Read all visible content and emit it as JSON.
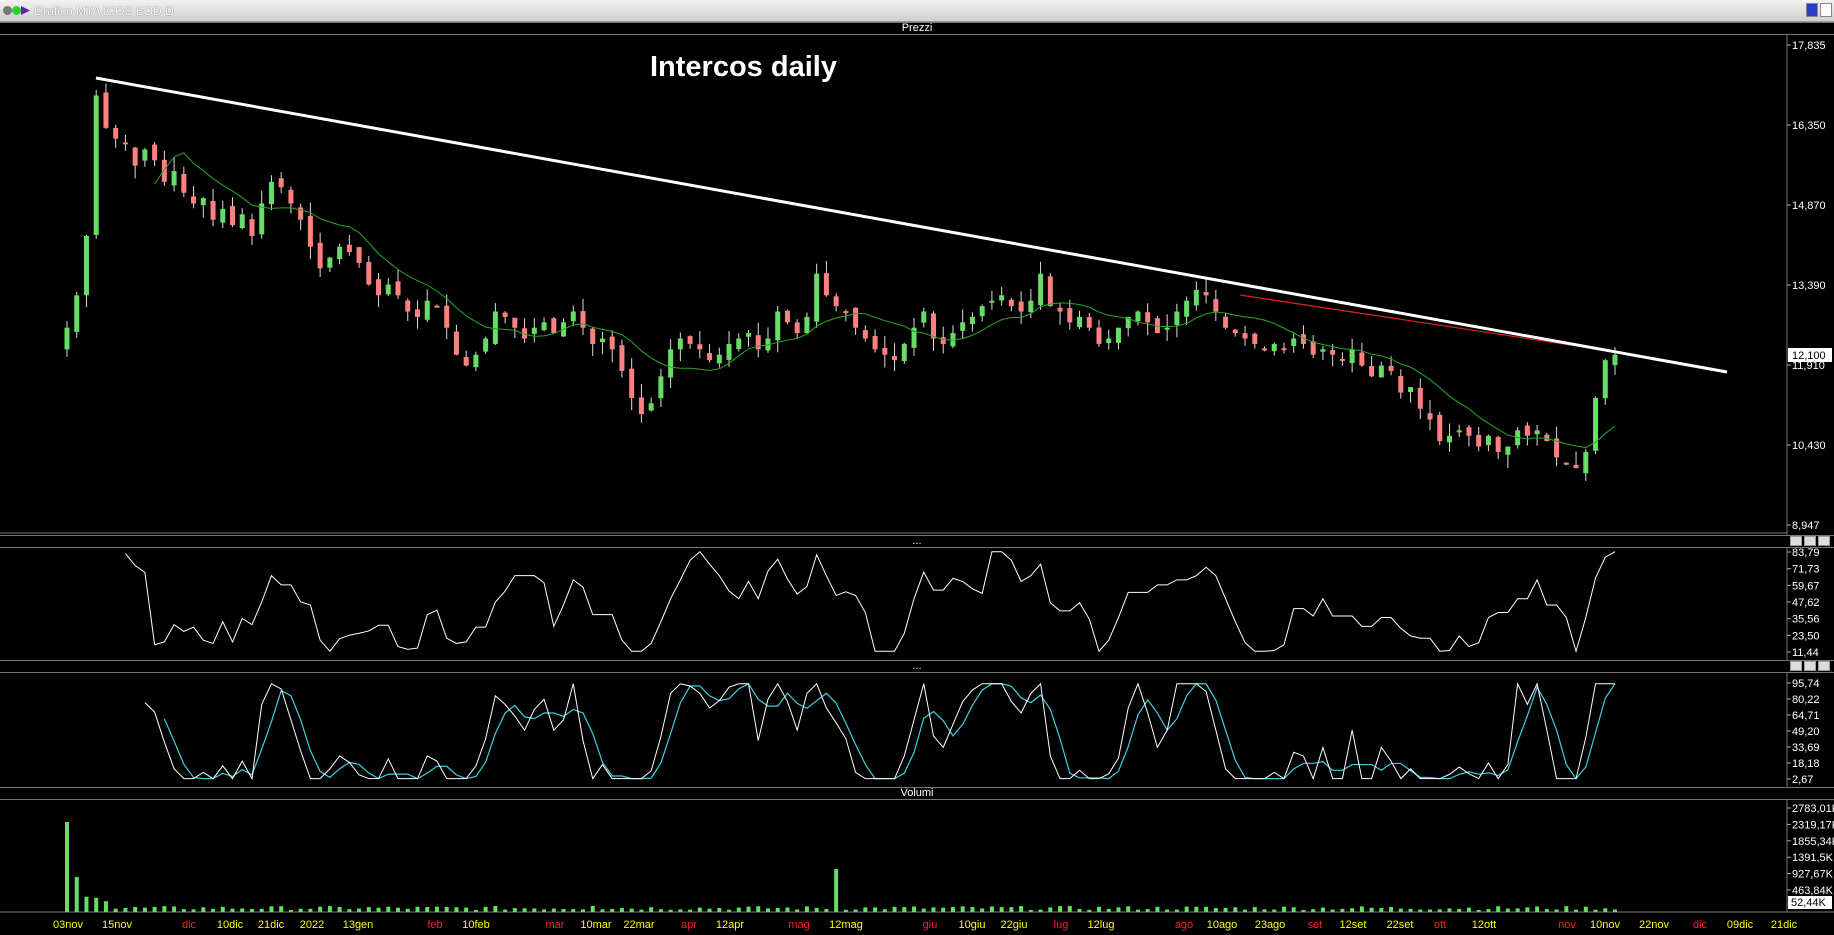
{
  "window": {
    "title": "Grafico MTA ICOS EOD D"
  },
  "panels": {
    "price": {
      "header": "Prezzi",
      "annotation": "Intercos daily",
      "ticks": [
        "17,835",
        "16,350",
        "14,870",
        "13,390",
        "11,910",
        "10,430",
        "8,947"
      ],
      "last_price": "12,100"
    },
    "osc1": {
      "header": "...",
      "ticks": [
        "83,79",
        "71,73",
        "59,67",
        "47,62",
        "35,56",
        "23,50",
        "11,44"
      ]
    },
    "osc2": {
      "header": "...",
      "ticks": [
        "95,74",
        "80,22",
        "64,71",
        "49,20",
        "33,69",
        "18,18",
        "2,67"
      ]
    },
    "volume": {
      "header": "Volumi",
      "ticks": [
        "2783,01K",
        "2319,17K",
        "1855,34K",
        "1391,5K",
        "927,67K",
        "463,84K"
      ],
      "last_volume": "52,44K"
    }
  },
  "date_axis": [
    {
      "label": "03nov",
      "color": "#ffff00"
    },
    {
      "label": "15nov",
      "color": "#ffff00"
    },
    {
      "label": "dic",
      "color": "#ff2020"
    },
    {
      "label": "10dic",
      "color": "#ffff00"
    },
    {
      "label": "21dic",
      "color": "#ffff00"
    },
    {
      "label": "2022",
      "color": "#ffff00"
    },
    {
      "label": "13gen",
      "color": "#ffff00"
    },
    {
      "label": "feb",
      "color": "#ff2020"
    },
    {
      "label": "10feb",
      "color": "#ffff00"
    },
    {
      "label": "mar",
      "color": "#ff2020"
    },
    {
      "label": "10mar",
      "color": "#ffff00"
    },
    {
      "label": "22mar",
      "color": "#ffff00"
    },
    {
      "label": "apr",
      "color": "#ff2020"
    },
    {
      "label": "12apr",
      "color": "#ffff00"
    },
    {
      "label": "mag",
      "color": "#ff2020"
    },
    {
      "label": "12mag",
      "color": "#ffff00"
    },
    {
      "label": "giu",
      "color": "#ff2020"
    },
    {
      "label": "10giu",
      "color": "#ffff00"
    },
    {
      "label": "22giu",
      "color": "#ffff00"
    },
    {
      "label": "lug",
      "color": "#ff2020"
    },
    {
      "label": "12lug",
      "color": "#ffff00"
    },
    {
      "label": "ago",
      "color": "#ff2020"
    },
    {
      "label": "10ago",
      "color": "#ffff00"
    },
    {
      "label": "23ago",
      "color": "#ffff00"
    },
    {
      "label": "set",
      "color": "#ff2020"
    },
    {
      "label": "12set",
      "color": "#ffff00"
    },
    {
      "label": "22set",
      "color": "#ffff00"
    },
    {
      "label": "ott",
      "color": "#ff2020"
    },
    {
      "label": "12ott",
      "color": "#ffff00"
    },
    {
      "label": "nov",
      "color": "#ff2020"
    },
    {
      "label": "10nov",
      "color": "#ffff00"
    },
    {
      "label": "22nov",
      "color": "#ffff00"
    },
    {
      "label": "dic",
      "color": "#ff2020"
    },
    {
      "label": "09dic",
      "color": "#ffff00"
    },
    {
      "label": "21dic",
      "color": "#ffff00"
    }
  ],
  "colors": {
    "up": "#66dd66",
    "down": "#ff8080",
    "ma": "#22aa22",
    "trend": "#ffffff",
    "trend2": "#cc2222",
    "stoch_k": "#ffffff",
    "stoch_d": "#40d0e0"
  },
  "chart_data": {
    "type": "candlestick",
    "close": [
      12.6,
      13.2,
      14.3,
      16.9,
      16.3,
      16.1,
      16.0,
      15.6,
      15.9,
      15.7,
      15.3,
      15.5,
      15.1,
      14.9,
      15.0,
      14.6,
      14.8,
      14.5,
      14.7,
      14.3,
      14.9,
      15.3,
      15.2,
      14.9,
      14.6,
      14.1,
      13.7,
      13.9,
      14.1,
      14.0,
      13.8,
      13.4,
      13.2,
      13.4,
      13.2,
      12.9,
      12.8,
      13.1,
      13.0,
      12.6,
      12.1,
      11.9,
      12.1,
      12.4,
      12.9,
      12.8,
      12.6,
      12.4,
      12.6,
      12.7,
      12.5,
      12.7,
      12.9,
      12.6,
      12.3,
      12.4,
      12.2,
      11.8,
      11.3,
      11.0,
      11.2,
      11.7,
      12.2,
      12.4,
      12.3,
      12.2,
      12.0,
      12.1,
      12.3,
      12.4,
      12.5,
      12.2,
      12.4,
      12.9,
      12.7,
      12.5,
      12.8,
      13.6,
      13.2,
      13.0,
      12.9,
      12.6,
      12.4,
      12.2,
      12.1,
      12.0,
      12.3,
      12.6,
      12.9,
      12.4,
      12.3,
      12.5,
      12.7,
      12.8,
      13.0,
      13.1,
      13.2,
      13.0,
      12.9,
      13.1,
      13.6,
      13.0,
      12.9,
      12.7,
      12.8,
      12.6,
      12.3,
      12.4,
      12.6,
      12.8,
      12.9,
      12.7,
      12.5,
      12.6,
      12.9,
      13.1,
      13.3,
      13.2,
      12.9,
      12.6,
      12.5,
      12.4,
      12.3,
      12.2,
      12.3,
      12.2,
      12.4,
      12.3,
      12.1,
      12.2,
      12.1,
      12.0,
      12.2,
      11.9,
      11.7,
      11.9,
      11.8,
      11.4,
      11.5,
      11.1,
      10.9,
      10.5,
      10.6,
      10.7,
      10.6,
      10.4,
      10.6,
      10.3,
      10.4,
      10.7,
      10.6,
      10.7,
      10.5,
      10.2,
      10.1,
      10.0,
      10.3,
      11.3,
      12.0,
      12.1
    ]
  }
}
